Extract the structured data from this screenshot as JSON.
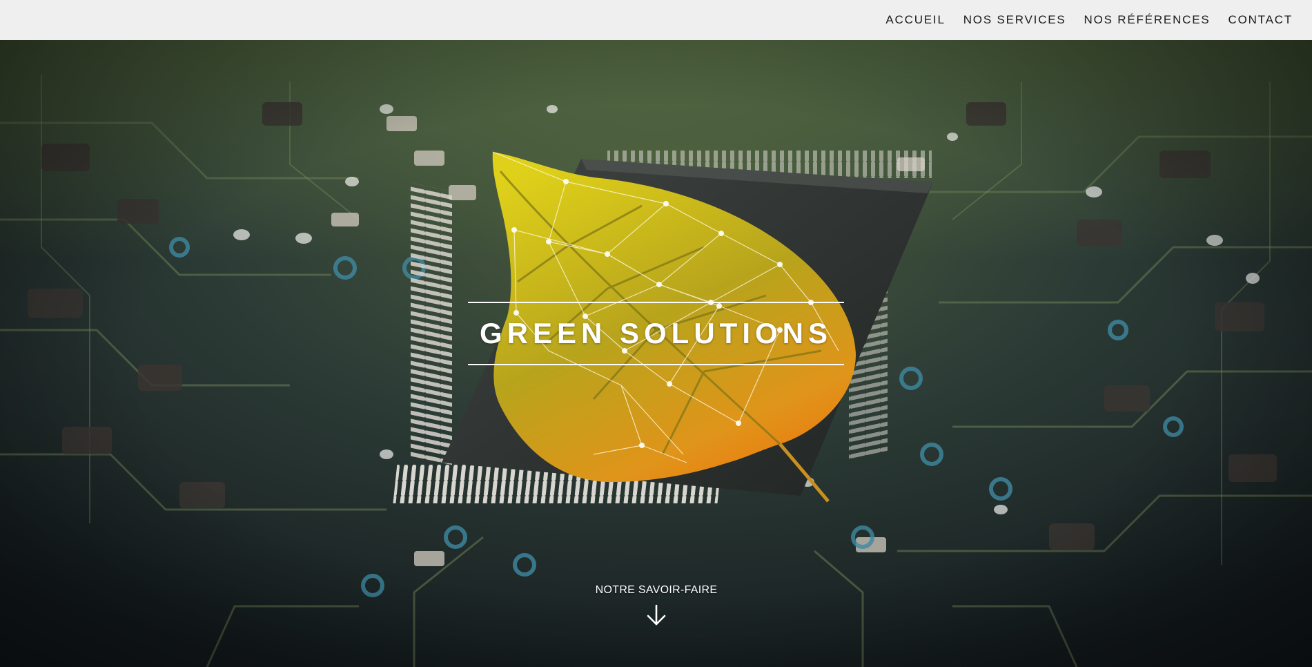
{
  "nav": {
    "items": [
      {
        "label": "ACCUEIL"
      },
      {
        "label": "NOS SERVICES"
      },
      {
        "label": "NOS RÉFÉRENCES"
      },
      {
        "label": "CONTACT"
      }
    ]
  },
  "hero": {
    "title": "GREEN SOLUTIONS",
    "cta_label": "NOTRE SAVOIR-FAIRE",
    "cta_icon": "arrow-down-icon"
  },
  "colors": {
    "topbar_bg": "#efefef",
    "nav_text": "#1a1a1a",
    "hero_text": "#ffffff",
    "leaf_yellow": "#d8c21a",
    "leaf_orange": "#e08a12",
    "board_dark": "#1f2a2a"
  }
}
